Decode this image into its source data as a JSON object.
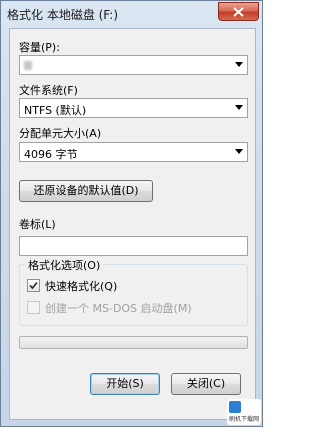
{
  "window": {
    "title": "格式化 本地磁盘 (F:)",
    "close_glyph": "✕"
  },
  "capacity": {
    "label": "容量(P):",
    "value": ""
  },
  "filesystem": {
    "label": "文件系统(F)",
    "value": "NTFS (默认)"
  },
  "allocation": {
    "label": "分配单元大小(A)",
    "value": "4096 字节"
  },
  "restore_defaults_label": "还原设备的默认值(D)",
  "volume_label": {
    "label": "卷标(L)",
    "value": ""
  },
  "format_options": {
    "title": "格式化选项(O)",
    "quick_format": {
      "label": "快速格式化(Q)",
      "checked": true
    },
    "msdos_startup": {
      "label": "创建一个 MS-DOS 启动盘(M)",
      "checked": false,
      "enabled": false
    }
  },
  "progress": {
    "value": 0
  },
  "buttons": {
    "start": "开始(S)",
    "close": "关闭(C)"
  },
  "watermark": {
    "text": "刷机下载网"
  }
}
